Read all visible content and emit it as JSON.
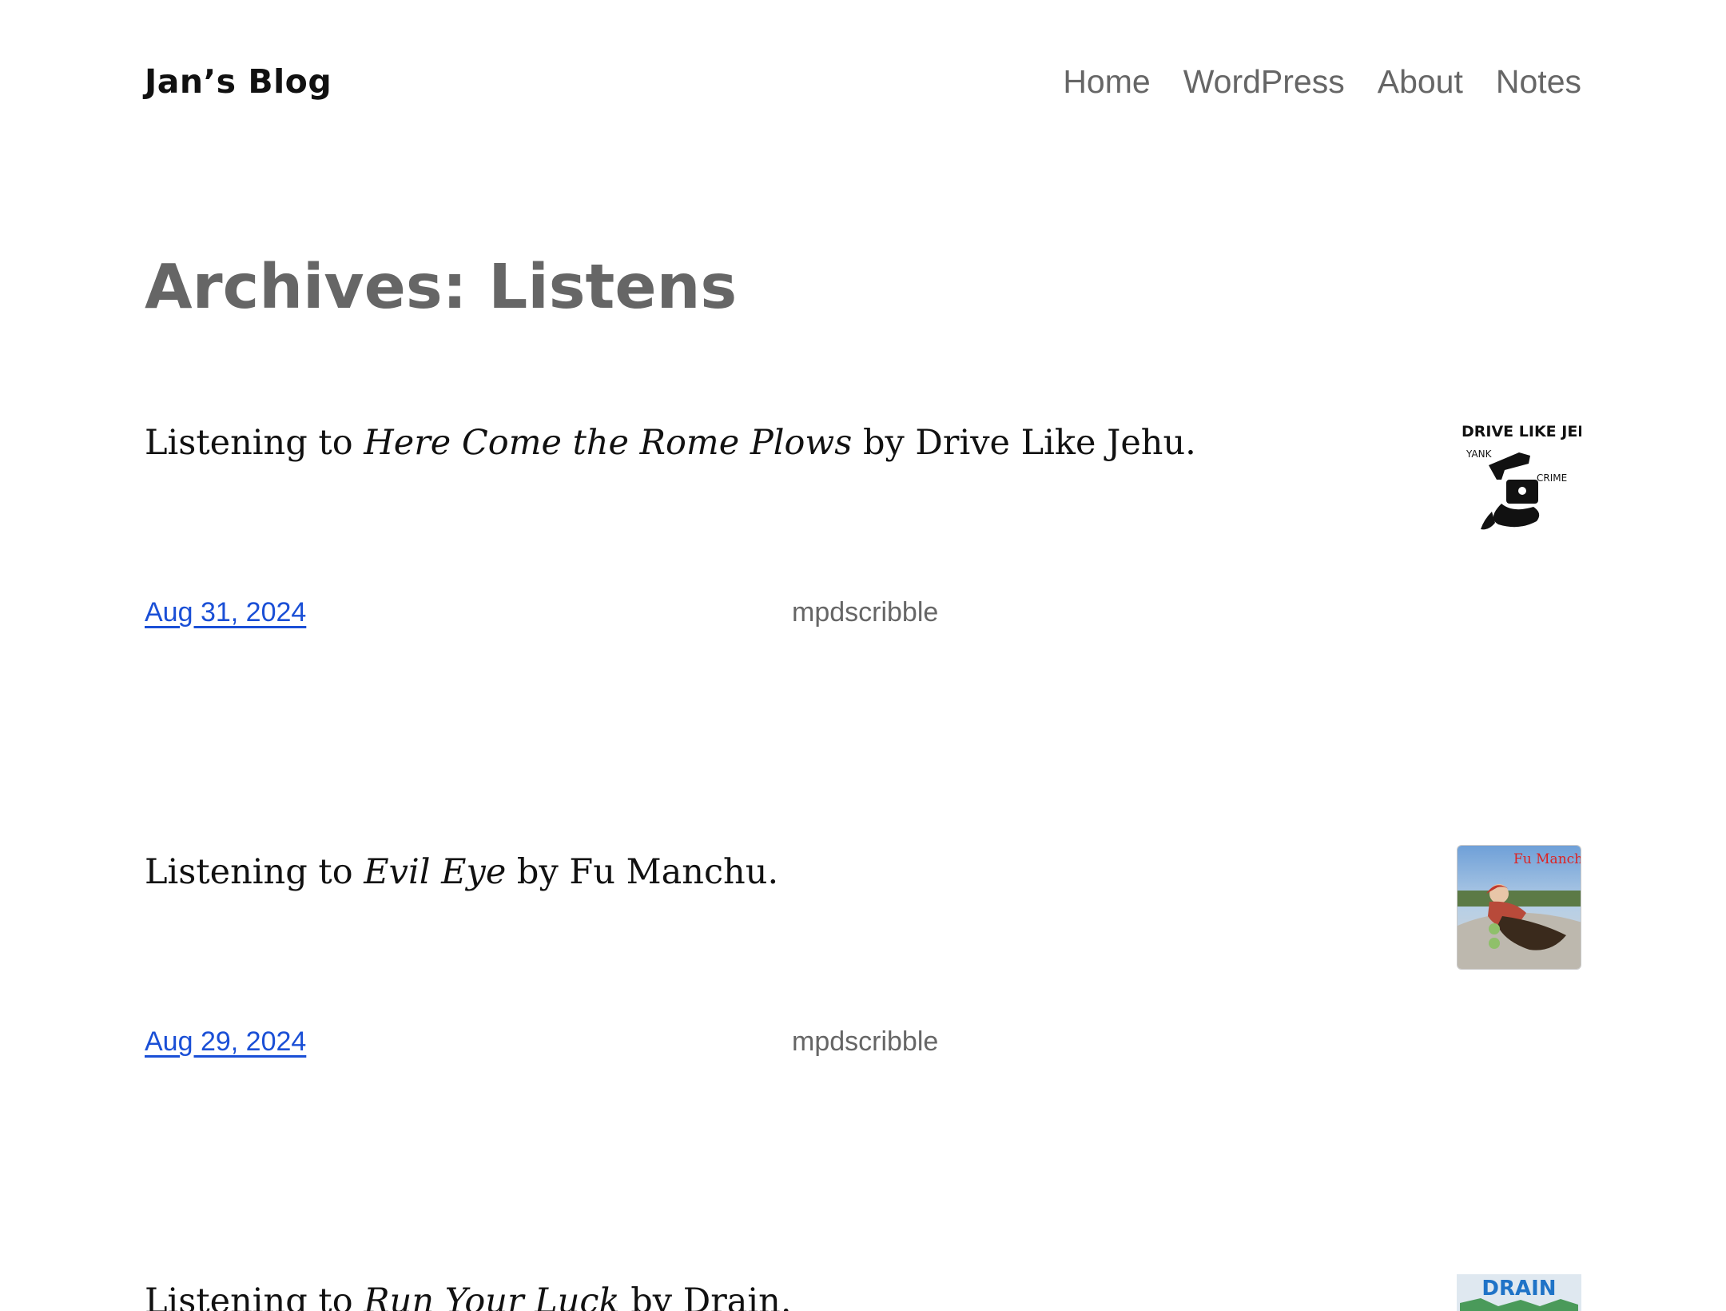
{
  "header": {
    "site_title": "Jan’s Blog",
    "nav": [
      "Home",
      "WordPress",
      "About",
      "Notes"
    ]
  },
  "archive": {
    "heading": "Archives: Listens"
  },
  "posts": [
    {
      "prefix": "Listening to ",
      "album": "Here Come the Rome Plows",
      "suffix": " by Drive Like Jehu.",
      "date": "Aug 31, 2024",
      "client": "mpdscribble",
      "cover_text": [
        "DRIVE LIKE JEHU",
        "YANK",
        "CRIME"
      ]
    },
    {
      "prefix": "Listening to ",
      "album": "Evil Eye",
      "suffix": " by Fu Manchu.",
      "date": "Aug 29, 2024",
      "client": "mpdscribble",
      "cover_text": [
        "Fu Manchu"
      ]
    },
    {
      "prefix": "Listening to ",
      "album": "Run Your Luck",
      "suffix": " by Drain.",
      "cover_text": [
        "DRAIN"
      ]
    }
  ]
}
